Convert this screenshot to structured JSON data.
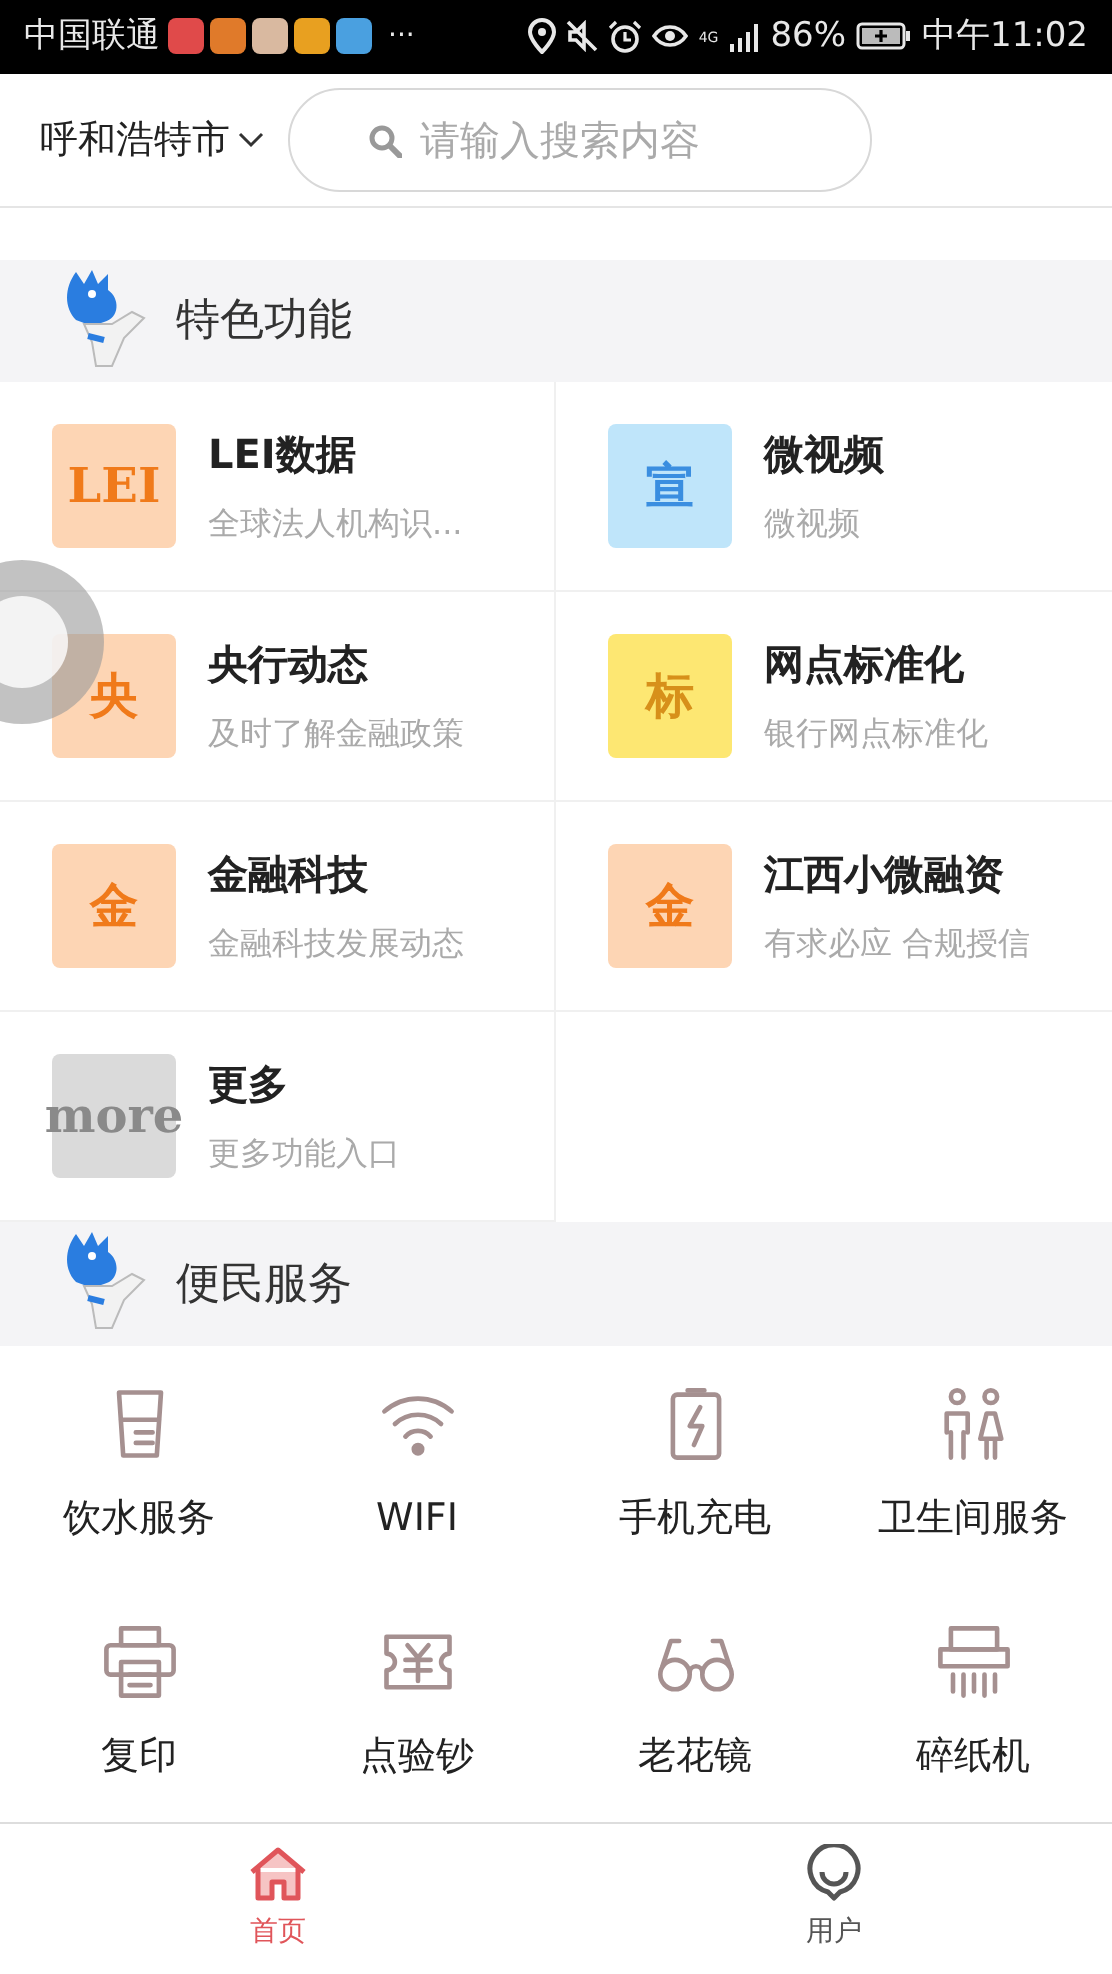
{
  "status_bar": {
    "carrier": "中国联通",
    "more": "···",
    "network": "4G",
    "battery": "86%",
    "time": "中午11:02"
  },
  "header": {
    "city": "呼和浩特市",
    "search": {
      "placeholder": "请输入搜索内容"
    }
  },
  "features": {
    "title": "特色功能",
    "items": [
      {
        "title": "LEI数据",
        "subtitle": "全球法人机构识...",
        "icon_text": "LEI",
        "color": "#f07a1a"
      },
      {
        "title": "微视频",
        "subtitle": "微视频",
        "icon_text": "宣",
        "color": "#3a8ee0"
      },
      {
        "title": "央行动态",
        "subtitle": "及时了解金融政策",
        "icon_text": "央",
        "color": "#f07a1a"
      },
      {
        "title": "网点标准化",
        "subtitle": "银行网点标准化",
        "icon_text": "标",
        "color": "#d7901a"
      },
      {
        "title": "金融科技",
        "subtitle": "金融科技发展动态",
        "icon_text": "金",
        "color": "#f07a1a"
      },
      {
        "title": "江西小微融资",
        "subtitle": "有求必应 合规授信",
        "icon_text": "金",
        "color": "#f07a1a"
      },
      {
        "title": "更多",
        "subtitle": "更多功能入口",
        "icon_text": "more",
        "color": "#8a8a8a"
      }
    ]
  },
  "services": {
    "title": "便民服务",
    "items": [
      {
        "label": "饮水服务",
        "kind": "cup"
      },
      {
        "label": "WIFI",
        "kind": "wifi"
      },
      {
        "label": "手机充电",
        "kind": "battery"
      },
      {
        "label": "卫生间服务",
        "kind": "restroom"
      },
      {
        "label": "复印",
        "kind": "printer"
      },
      {
        "label": "点验钞",
        "kind": "cash"
      },
      {
        "label": "老花镜",
        "kind": "glasses"
      },
      {
        "label": "碎纸机",
        "kind": "shredder"
      }
    ]
  },
  "tabs": [
    {
      "label": "首页",
      "kind": "home",
      "selected": true
    },
    {
      "label": "用户",
      "kind": "user",
      "selected": false
    }
  ]
}
